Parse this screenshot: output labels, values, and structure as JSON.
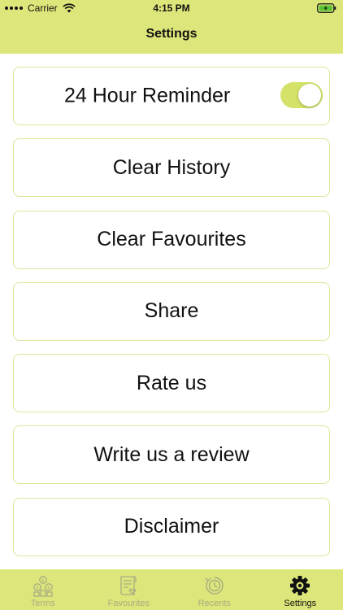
{
  "status_bar": {
    "carrier": "Carrier",
    "time": "4:15 PM"
  },
  "header": {
    "title": "Settings"
  },
  "settings": {
    "reminder": {
      "label": "24 Hour Reminder",
      "enabled": true
    },
    "items": [
      {
        "label": "Clear History"
      },
      {
        "label": "Clear Favourites"
      },
      {
        "label": "Share"
      },
      {
        "label": "Rate us"
      },
      {
        "label": "Write us a review"
      },
      {
        "label": "Disclaimer"
      }
    ]
  },
  "tab_bar": {
    "tabs": [
      {
        "label": "Terms",
        "icon": "terms-icon",
        "active": false
      },
      {
        "label": "Favourites",
        "icon": "favourites-icon",
        "active": false
      },
      {
        "label": "Recents",
        "icon": "recents-icon",
        "active": false
      },
      {
        "label": "Settings",
        "icon": "gear-icon",
        "active": true
      }
    ]
  },
  "colors": {
    "accent": "#dde67a",
    "border": "#dfe49a",
    "toggle_on": "#d4e26a",
    "inactive_tab": "#a9ad82"
  }
}
